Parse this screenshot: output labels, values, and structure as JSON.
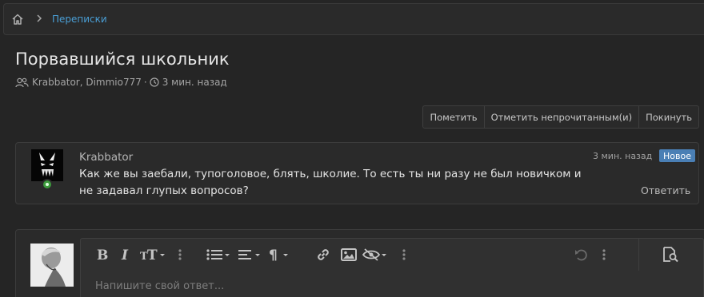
{
  "breadcrumb": {
    "home_icon": "home-icon",
    "separator_icon": "chevron-right-icon",
    "link": "Переписки"
  },
  "page": {
    "title": "Порвавшийся школьник",
    "participants": "Krabbator, Dimmio777",
    "separator": "·",
    "time": "3 мин. назад"
  },
  "actions": {
    "mark": "Пометить",
    "mark_unread": "Отметить непрочитанным(и)",
    "leave": "Покинуть"
  },
  "message": {
    "author": "Krabbator",
    "time": "3 мин. назад",
    "badge": "Новое",
    "text": "Как же вы заебали, тупоголовое, блять, школие. То есть ты ни разу не был новичком и не задавал глупых вопросов?",
    "reply": "Ответить"
  },
  "editor": {
    "placeholder": "Напишите свой ответ..."
  },
  "colors": {
    "background": "#252525",
    "link": "#4a9fd6",
    "badge": "#4a7fb5",
    "online": "#3c9a3c"
  }
}
